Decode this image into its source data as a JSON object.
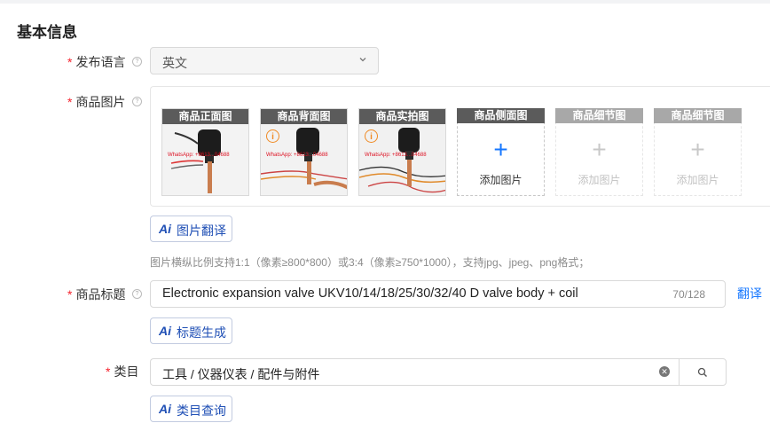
{
  "section": {
    "title": "基本信息"
  },
  "language": {
    "label": "发布语言",
    "value": "英文"
  },
  "images": {
    "label": "商品图片",
    "slots": [
      {
        "title": "商品正面图",
        "state": "filled",
        "warning": false
      },
      {
        "title": "商品背面图",
        "state": "filled",
        "warning": true
      },
      {
        "title": "商品实拍图",
        "state": "filled",
        "warning": true
      },
      {
        "title": "商品侧面图",
        "state": "empty",
        "add_label": "添加图片"
      },
      {
        "title": "商品细节图",
        "state": "disabled",
        "add_label": "添加图片"
      },
      {
        "title": "商品细节图",
        "state": "disabled",
        "add_label": "添加图片"
      }
    ],
    "watermark_texts": [
      "WhatsApp: +8613...04688",
      "WhatsApp: +8613...04688",
      "WhatsApp: +8613...04688"
    ],
    "translate_button": "图片翻译",
    "hint": "图片横纵比例支持1:1（像素≥800*800）或3:4（像素≥750*1000），支持jpg、jpeg、png格式；"
  },
  "title_field": {
    "label": "商品标题",
    "value": "Electronic expansion valve UKV10/14/18/25/30/32/40 D valve body + coil",
    "count": "70/128",
    "translate_link": "翻译",
    "generate_button": "标题生成"
  },
  "category": {
    "label": "类目",
    "value": "工具 / 仪器仪表 / 配件与附件",
    "lookup_button": "类目查询"
  },
  "ai_badge": "Ai",
  "required_mark": "*",
  "icons": {
    "help": "question-circle-icon",
    "chevron": "chevron-down-icon",
    "clear": "close-circle-icon",
    "search": "search-icon",
    "warning": "info-circle-icon",
    "plus": "plus-icon"
  },
  "colors": {
    "accent": "#1677ff",
    "ai_blue": "#1f4fb5",
    "required": "#f5222d",
    "warning": "#f08a24"
  }
}
